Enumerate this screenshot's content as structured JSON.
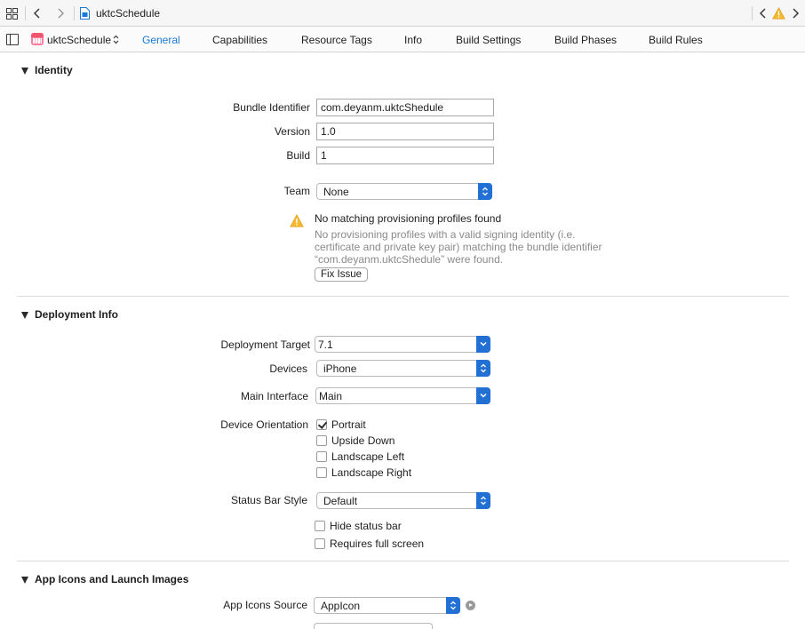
{
  "jumpbar": {
    "title": "uktcSchedule",
    "icons": [
      "grid-icon",
      "back-icon",
      "forward-icon",
      "file-icon",
      "left-chevron-icon",
      "warning-icon",
      "right-chevron-icon"
    ]
  },
  "tabbar": {
    "target": "uktcSchedule",
    "tabs": [
      "General",
      "Capabilities",
      "Resource Tags",
      "Info",
      "Build Settings",
      "Build Phases",
      "Build Rules"
    ],
    "active_tab": "General"
  },
  "identity": {
    "header": "Identity",
    "bundle_identifier_label": "Bundle Identifier",
    "bundle_identifier_value": "com.deyanm.uktcShedule",
    "version_label": "Version",
    "version_value": "1.0",
    "build_label": "Build",
    "build_value": "1",
    "team_label": "Team",
    "team_value": "None",
    "warning_title": "No matching provisioning profiles found",
    "warning_desc": "No provisioning profiles with a valid signing identity (i.e. certificate and private key pair) matching the bundle identifier “com.deyanm.uktcShedule” were found.",
    "fix_button": "Fix Issue"
  },
  "deployment": {
    "header": "Deployment Info",
    "target_label": "Deployment Target",
    "target_value": "7.1",
    "devices_label": "Devices",
    "devices_value": "iPhone",
    "main_interface_label": "Main Interface",
    "main_interface_value": "Main",
    "orientation_label": "Device Orientation",
    "orientations": [
      {
        "label": "Portrait",
        "checked": true
      },
      {
        "label": "Upside Down",
        "checked": false
      },
      {
        "label": "Landscape Left",
        "checked": false
      },
      {
        "label": "Landscape Right",
        "checked": false
      }
    ],
    "status_bar_label": "Status Bar Style",
    "status_bar_value": "Default",
    "hide_status_bar": {
      "label": "Hide status bar",
      "checked": false
    },
    "requires_full_screen": {
      "label": "Requires full screen",
      "checked": false
    }
  },
  "app_icons": {
    "header": "App Icons and Launch Images",
    "source_label": "App Icons Source",
    "source_value": "AppIcon"
  },
  "colors": {
    "accent": "#1b78d6",
    "popup_arrow": "#2270d4",
    "warning": "#f5b82e"
  }
}
